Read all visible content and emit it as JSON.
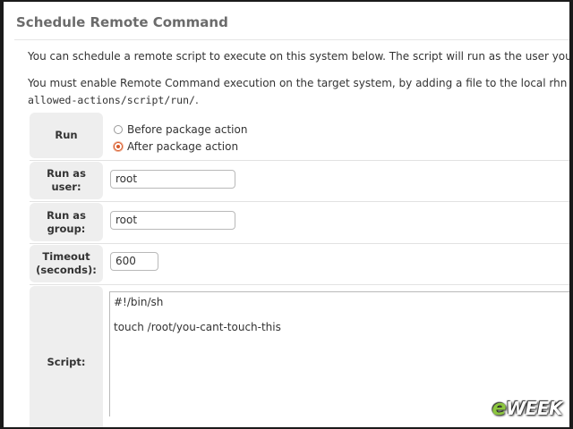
{
  "page": {
    "title": "Schedule Remote Command",
    "intro_1": "You can schedule a remote script to execute on this system below. The script will run as the user you specify.",
    "intro_2": "You must enable Remote Command execution on the target system, by adding a file to the local rhn configuration",
    "intro_2_path": "allowed-actions/script/run/",
    "intro_2_end": "."
  },
  "form": {
    "run": {
      "label": "Run",
      "options": [
        {
          "label": "Before package action",
          "checked": false
        },
        {
          "label": "After package action",
          "checked": true
        }
      ]
    },
    "run_as_user": {
      "label_line1": "Run as",
      "label_line2": "user:",
      "value": "root"
    },
    "run_as_group": {
      "label_line1": "Run as",
      "label_line2": "group:",
      "value": "root"
    },
    "timeout": {
      "label_line1": "Timeout",
      "label_line2": "(seconds):",
      "value": "600"
    },
    "script": {
      "label": "Script:",
      "lines": [
        "#!/bin/sh",
        "",
        "touch /root/you-cant-touch-this"
      ]
    }
  },
  "watermark": {
    "prefix": "e",
    "rest": "WEEK"
  }
}
